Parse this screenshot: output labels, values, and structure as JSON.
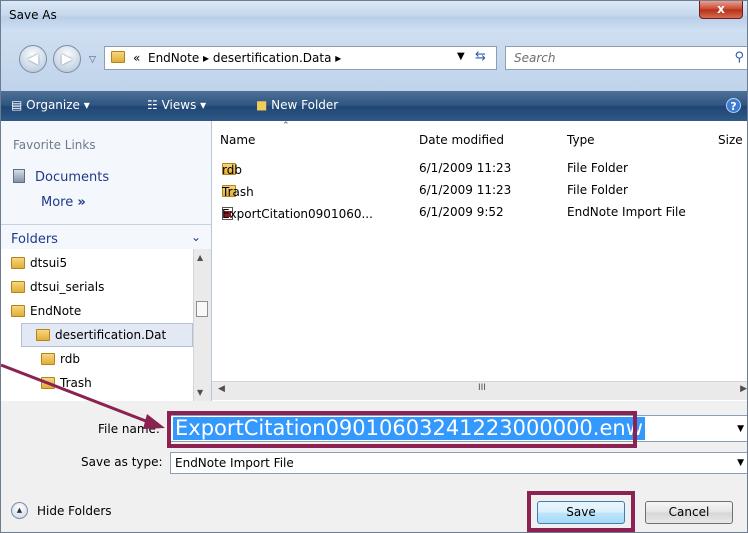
{
  "window": {
    "title": "Save As",
    "close_label": "x"
  },
  "address_bar": {
    "crumbs": [
      "EndNote",
      "desertification.Data"
    ],
    "overflow_glyph": "«",
    "separator_glyph": "▸",
    "search_placeholder": "Search"
  },
  "toolbar": {
    "organize_label": "Organize",
    "views_label": "Views",
    "new_folder_label": "New Folder"
  },
  "nav_pane": {
    "favorite_links_title": "Favorite Links",
    "favorite_items": [
      {
        "label": "Documents"
      }
    ],
    "more_label": "More",
    "folders_title": "Folders",
    "tree": [
      {
        "label": "dtsui5",
        "level": 0
      },
      {
        "label": "dtsui_serials",
        "level": 0
      },
      {
        "label": "EndNote",
        "level": 0
      },
      {
        "label": "desertification.Dat",
        "level": 1,
        "selected": true
      },
      {
        "label": "rdb",
        "level": 2
      },
      {
        "label": "Trash",
        "level": 2
      }
    ]
  },
  "file_list": {
    "columns": [
      "Name",
      "Date modified",
      "Type",
      "Size"
    ],
    "rows": [
      {
        "name": "rdb",
        "date": "6/1/2009 11:23",
        "type": "File Folder",
        "icon": "folder-icon"
      },
      {
        "name": "Trash",
        "date": "6/1/2009 11:23",
        "type": "File Folder",
        "icon": "folder-icon"
      },
      {
        "name": "ExportCitation0901060...",
        "date": "6/1/2009 9:52",
        "type": "EndNote Import File",
        "icon": "endnote-file-icon"
      }
    ],
    "scroll_grip": "III"
  },
  "form": {
    "file_name_label": "File name:",
    "file_name_value": "ExportCitation09010603241223000000.enw",
    "save_as_type_label": "Save as type:",
    "save_as_type_value": "EndNote Import File",
    "hide_folders_label": "Hide Folders",
    "save_label": "Save",
    "cancel_label": "Cancel"
  },
  "annotations": {
    "highlight_color": "#8b2252"
  }
}
